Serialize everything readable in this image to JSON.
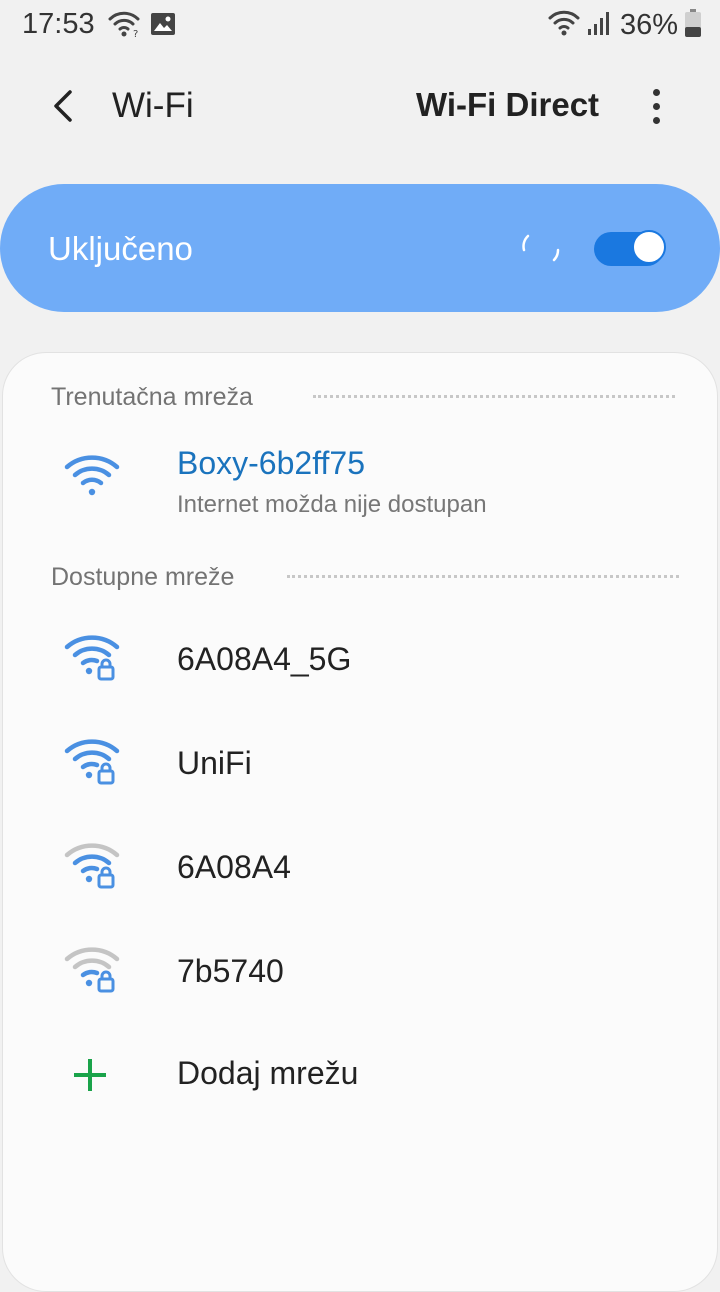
{
  "status_bar": {
    "time": "17:53",
    "left_icons": [
      "wifi-icon",
      "image-icon"
    ],
    "right_icons": [
      "wifi-icon",
      "signal-icon",
      "battery-icon"
    ],
    "battery_percent": "36%"
  },
  "app_bar": {
    "back_icon": "chevron-left-icon",
    "title": "Wi-Fi",
    "wifi_direct_label": "Wi-Fi Direct",
    "more_icon": "more-vertical-icon"
  },
  "master_toggle": {
    "label": "Uključeno",
    "on": true,
    "scanning": true
  },
  "current_section": {
    "header": "Trenutačna mreža",
    "network": {
      "name": "Boxy-6b2ff75",
      "status": "Internet možda nije dostupan",
      "icon": "wifi-icon",
      "color": "#1a73bd"
    }
  },
  "available_section": {
    "header": "Dostupne mreže",
    "networks": [
      {
        "name": "6A08A4_5G",
        "icon": "wifi-lock-icon",
        "strength": "strong"
      },
      {
        "name": "UniFi",
        "icon": "wifi-lock-icon",
        "strength": "strong"
      },
      {
        "name": "6A08A4",
        "icon": "wifi-lock-icon",
        "strength": "weak"
      },
      {
        "name": "7b5740",
        "icon": "wifi-lock-icon",
        "strength": "weak"
      }
    ],
    "add_network": {
      "label": "Dodaj mrežu",
      "icon": "plus-icon"
    }
  },
  "colors": {
    "accent": "#1a78e0",
    "toggle_card": "#70acf7",
    "wifi_strong": "#4a90e2",
    "wifi_weak": "#c4c4c4",
    "add_green": "#1aa34a"
  }
}
